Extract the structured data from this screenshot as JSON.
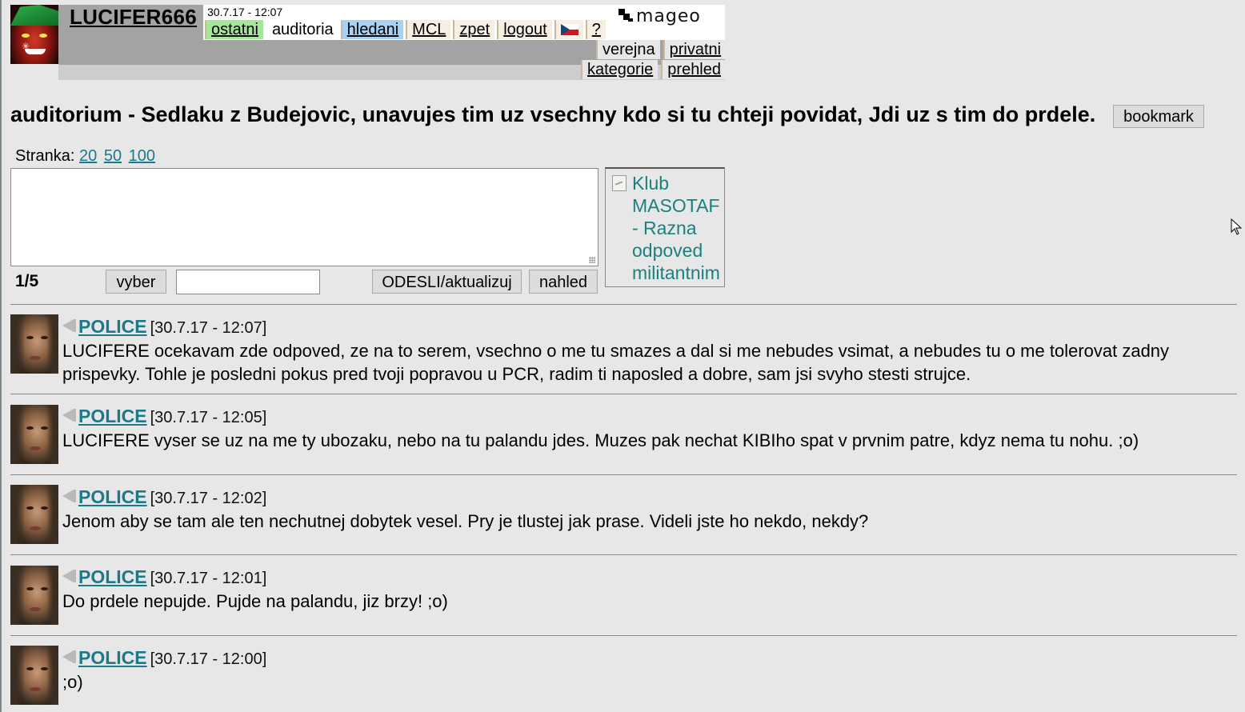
{
  "header": {
    "username": "LUCIFER666",
    "datetime": "30.7.17 - 12:07",
    "logo_text": "mageo",
    "menu": [
      {
        "label": "ostatni",
        "style": "green",
        "link": true
      },
      {
        "label": "auditoria",
        "style": "plain",
        "link": false
      },
      {
        "label": "hledani",
        "style": "blue",
        "link": true
      },
      {
        "label": "MCL",
        "style": "sand",
        "link": true
      },
      {
        "label": "zpet",
        "style": "sand",
        "link": true
      },
      {
        "label": "logout",
        "style": "sand",
        "link": true
      },
      {
        "label": "?",
        "style": "sand",
        "link": true
      }
    ],
    "submenu_row1": [
      "verejna",
      "privatni"
    ],
    "submenu_row2": [
      "kategorie",
      "prehled"
    ]
  },
  "page": {
    "title": "auditorium - Sedlaku z Budejovic, unavujes tim uz vsechny kdo si tu chteji povidat, Jdi uz s tim do prdele.",
    "bookmark_label": "bookmark"
  },
  "form": {
    "pager_label": "Stranka:",
    "pager_options": [
      "20",
      "50",
      "100"
    ],
    "page_count": "1/5",
    "vyber_label": "vyber",
    "send_label": "ODESLI/aktualizuj",
    "preview_label": "nahled",
    "klub_text": [
      "Klub",
      "MASOTAF",
      "- Razna",
      "odpoved",
      "militantnim"
    ]
  },
  "posts": [
    {
      "author": "POLICE",
      "date": "[30.7.17 - 12:07]",
      "text": "LUCIFERE ocekavam zde odpoved, ze na to serem, vsechno o me tu smazes a dal si me nebudes vsimat, a nebudes tu o me tolerovat zadny prispevky. Tohle je posledni pokus pred tvoji popravou u PCR, radim ti naposled a dobre, sam jsi svyho stesti strujce."
    },
    {
      "author": "POLICE",
      "date": "[30.7.17 - 12:05]",
      "text": "LUCIFERE vyser se uz na me ty ubozaku, nebo na tu palandu jdes. Muzes pak nechat KIBIho spat v prvnim patre, kdyz nema tu nohu. ;o)"
    },
    {
      "author": "POLICE",
      "date": "[30.7.17 - 12:02]",
      "text": "Jenom aby se tam ale ten nechutnej dobytek vesel. Pry je tlustej jak prase. Videli jste ho nekdo, nekdy?"
    },
    {
      "author": "POLICE",
      "date": "[30.7.17 - 12:01]",
      "text": "Do prdele nepujde. Pujde na palandu, jiz brzy! ;o)"
    },
    {
      "author": "POLICE",
      "date": "[30.7.17 - 12:00]",
      "text": ";o)"
    }
  ]
}
